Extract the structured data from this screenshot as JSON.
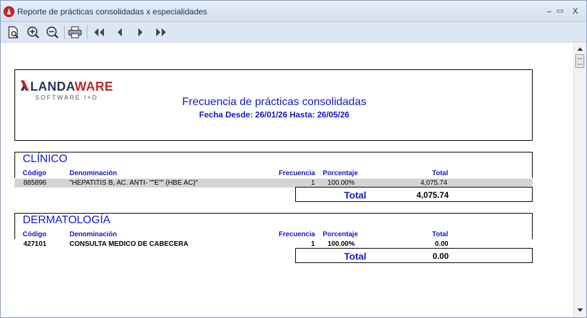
{
  "window": {
    "title": "Reporte de prácticas consolidadas x especialidades",
    "controls": {
      "minimize": "–",
      "maximize": "▭",
      "close": "X"
    }
  },
  "toolbar": {
    "items": [
      "preview-icon",
      "zoom-in-icon",
      "zoom-out-icon",
      "print-icon",
      "first-page-icon",
      "prev-page-icon",
      "next-page-icon",
      "last-page-icon"
    ]
  },
  "report": {
    "logo": {
      "brand_a": "LANDA",
      "brand_b": "WARE",
      "tagline": "SOFTWARE I+D"
    },
    "title": "Frecuencia de prácticas consolidadas",
    "subtitle": "Fecha Desde: 26/01/26 Hasta: 26/05/26",
    "headers": {
      "codigo": "Código",
      "denominacion": "Denominación",
      "frecuencia": "Frecuencia",
      "porcentaje": "Porcentaje",
      "total": "Total"
    },
    "total_label": "Total",
    "sections": [
      {
        "name": "CLÍNICO",
        "rows": [
          {
            "codigo": "885896",
            "denominacion": "\"HEPATITIS B, AC. ANTI- \"\"E\"\" (HBE AC)\"",
            "frecuencia": "1",
            "porcentaje": "100.00%",
            "total": "4,075.74"
          }
        ],
        "total": "4,075.74"
      },
      {
        "name": "DERMATOLOGÍA",
        "rows": [
          {
            "codigo": "427101",
            "denominacion": "CONSULTA MEDICO DE CABECERA",
            "frecuencia": "1",
            "porcentaje": "100.00%",
            "total": "0.00"
          }
        ],
        "total": "0.00"
      }
    ]
  }
}
